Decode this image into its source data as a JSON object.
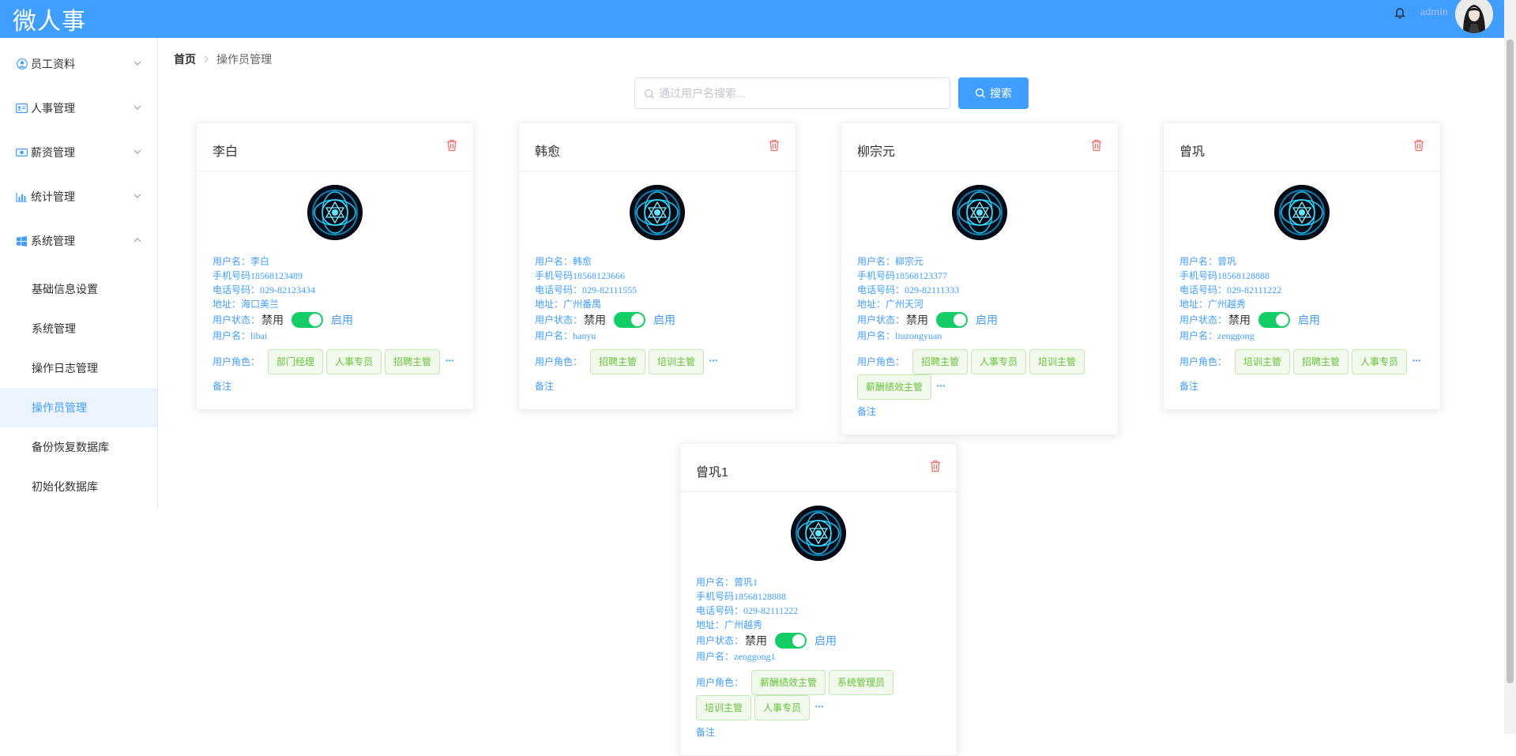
{
  "header": {
    "app_title": "微人事",
    "username": "admin",
    "colors": {
      "primary": "#409eff"
    }
  },
  "sidebar": {
    "menus": [
      {
        "label": "员工资料",
        "icon": "user-circle-icon",
        "expanded": false
      },
      {
        "label": "人事管理",
        "icon": "id-card-icon",
        "expanded": false
      },
      {
        "label": "薪资管理",
        "icon": "money-icon",
        "expanded": false
      },
      {
        "label": "统计管理",
        "icon": "bar-chart-icon",
        "expanded": false
      },
      {
        "label": "系统管理",
        "icon": "windows-icon",
        "expanded": true
      }
    ],
    "sub_items": [
      {
        "label": "基础信息设置",
        "active": false
      },
      {
        "label": "系统管理",
        "active": false
      },
      {
        "label": "操作日志管理",
        "active": false
      },
      {
        "label": "操作员管理",
        "active": true
      },
      {
        "label": "备份恢复数据库",
        "active": false
      },
      {
        "label": "初始化数据库",
        "active": false
      }
    ]
  },
  "breadcrumb": {
    "home": "首页",
    "current": "操作员管理"
  },
  "search": {
    "placeholder": "通过用户名搜索...",
    "button_label": "搜索"
  },
  "labels": {
    "username": "用户名：",
    "phone": "手机号码",
    "telephone": "电话号码：",
    "address": "地址：",
    "status": "用户状态：",
    "disabled": "禁用",
    "enabled": "启用",
    "login_name": "用户名：",
    "roles": "用户角色：",
    "remark": "备注",
    "more": "···"
  },
  "cards": [
    {
      "name": "李白",
      "username": "李白",
      "phone": "18568123489",
      "telephone": "029-82123434",
      "address": "海口美兰",
      "enabled": true,
      "login": "libai",
      "roles": [
        "部门经理",
        "人事专员",
        "招聘主管"
      ]
    },
    {
      "name": "韩愈",
      "username": "韩愈",
      "phone": "18568123666",
      "telephone": "029-82111555",
      "address": "广州番禺",
      "enabled": true,
      "login": "hanyu",
      "roles": [
        "招聘主管",
        "培训主管"
      ]
    },
    {
      "name": "柳宗元",
      "username": "柳宗元",
      "phone": "18568123377",
      "telephone": "029-82111333",
      "address": "广州天河",
      "enabled": true,
      "login": "liuzongyuan",
      "roles": [
        "招聘主管",
        "人事专员",
        "培训主管",
        "薪酬绩效主管"
      ]
    },
    {
      "name": "曾巩",
      "username": "曾巩",
      "phone": "18568128888",
      "telephone": "029-82111222",
      "address": "广州越秀",
      "enabled": true,
      "login": "zenggong",
      "roles": [
        "培训主管",
        "招聘主管",
        "人事专员"
      ]
    },
    {
      "name": "曾巩1",
      "username": "曾巩1",
      "phone": "18568128888",
      "telephone": "029-82111222",
      "address": "广州越秀",
      "enabled": true,
      "login": "zenggong1",
      "roles": [
        "薪酬绩效主管",
        "系统管理员",
        "培训主管",
        "人事专员"
      ]
    }
  ]
}
